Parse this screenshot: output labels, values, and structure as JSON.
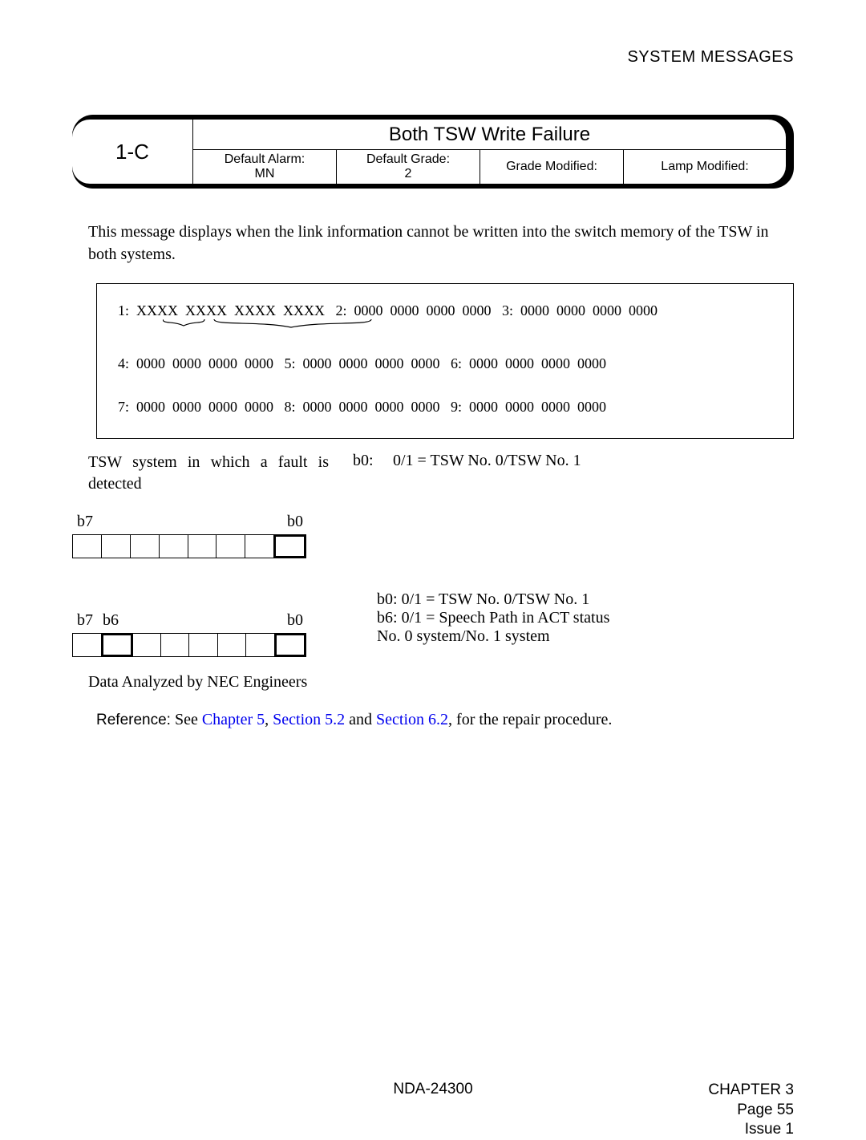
{
  "header": {
    "sys_msg": "SYSTEM MESSAGES"
  },
  "title_block": {
    "code": "1-C",
    "title": "Both TSW Write Failure",
    "meta": {
      "alarm_label": "Default Alarm:",
      "alarm_value": "MN",
      "grade_label": "Default Grade:",
      "grade_value": "2",
      "grade_mod_label": "Grade Modified:",
      "lamp_mod_label": "Lamp Modified:"
    }
  },
  "description": "This message displays when the link information cannot be written into the switch memory of the TSW in both systems.",
  "dump": {
    "rows": [
      "1:  XXXX  XXXX  XXXX  XXXX   2:  0000  0000  0000  0000   3:  0000  0000  0000  0000",
      "4:  0000  0000  0000  0000   5:  0000  0000  0000  0000   6:  0000  0000  0000  0000",
      "7:  0000  0000  0000  0000   8:  0000  0000  0000  0000   9:  0000  0000  0000  0000"
    ]
  },
  "section1": {
    "left": "TSW system in which a fault is detected",
    "b0_key": "b0:",
    "b0_val": "0/1 = TSW No. 0/TSW No. 1",
    "bit_hi": "b7",
    "bit_lo": "b0"
  },
  "section2": {
    "bit_hi": "b7",
    "bit_6": "b6",
    "bit_lo": "b0",
    "b0_key": "b0:",
    "b0_val": "0/1 = TSW No. 0/TSW No. 1",
    "b6_key": "b6:",
    "b6_val": "0/1 = Speech Path in ACT status",
    "b6_val2": "No. 0 system/No. 1 system"
  },
  "analyzed": "Data Analyzed by NEC Engineers",
  "reference": {
    "label": "Reference:",
    "pre": "See ",
    "ch5": "Chapter 5",
    "c1": ", ",
    "s52": "Section 5.2",
    "c2": " and ",
    "s62": "Section 6.2",
    "post": ", for the repair procedure."
  },
  "footer": {
    "doc": "NDA-24300",
    "chapter": "CHAPTER 3",
    "page": "Page 55",
    "issue": "Issue 1"
  }
}
